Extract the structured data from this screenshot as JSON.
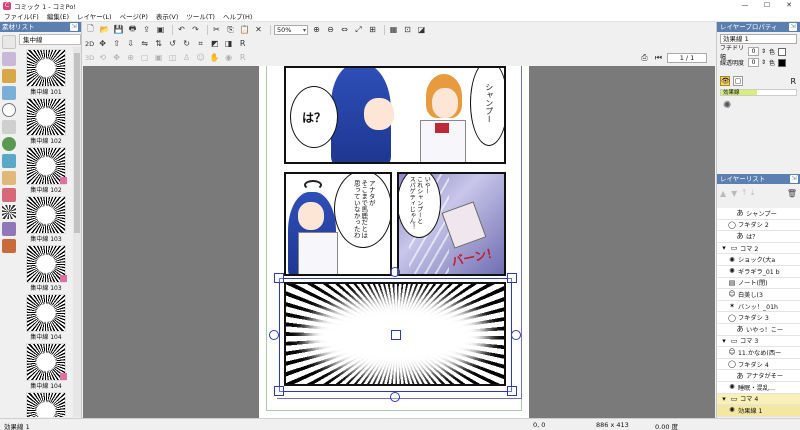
{
  "window": {
    "title": "コミック 1 - コミPo!",
    "app_icon": "comipo-app-icon",
    "controls": [
      "—",
      "☐",
      "✕"
    ]
  },
  "menu": [
    "ファイル(F)",
    "編集(E)",
    "レイヤー(L)",
    "ページ(P)",
    "表示(V)",
    "ツール(T)",
    "ヘルプ(H)"
  ],
  "left_panel": {
    "title": "素材リスト",
    "folder": "集中線",
    "materials": [
      {
        "label": "集中線 101",
        "marked": false
      },
      {
        "label": "集中線 102",
        "marked": false
      },
      {
        "label": "集中線 102",
        "marked": true
      },
      {
        "label": "集中線 103",
        "marked": false
      },
      {
        "label": "集中線 103",
        "marked": true
      },
      {
        "label": "集中線 104",
        "marked": false
      },
      {
        "label": "集中線 104",
        "marked": true
      },
      {
        "label": "",
        "marked": false
      }
    ]
  },
  "toolbar": {
    "zoom": "50%",
    "mode": "2D",
    "page_indicator": "1 / 1"
  },
  "canvas": {
    "bubbles": {
      "top_left": "は？",
      "top_right": "シャンプー",
      "mid_left": "アナタが\nそこまで馬鹿だとは\n思っていなかったわ",
      "mid_right": "いやー\nこれシャンプーと\nスパゲティじゃん！",
      "sfx": "バーン！"
    }
  },
  "right_panel": {
    "properties_title": "レイヤープロパティ",
    "layer_name": "効果線 1",
    "border_width_label": "フチドリ幅",
    "border_width_value": "0",
    "border_color_label": "色",
    "line_opacity_label": "線透明度",
    "line_opacity_value": "0",
    "line_color_label": "色",
    "effect_label": "効果線",
    "layers_title": "レイヤーリスト",
    "layers": [
      {
        "label": "シャンプー",
        "indent": 2,
        "icon": "text-a-icon",
        "sel": false
      },
      {
        "label": "フキダシ 2",
        "indent": 1,
        "icon": "bubble-icon",
        "sel": false
      },
      {
        "label": "は？",
        "indent": 2,
        "icon": "text-a-icon",
        "sel": false
      },
      {
        "label": "コマ 2",
        "indent": 0,
        "icon": "frame-icon",
        "sel": false
      },
      {
        "label": "ショック(大a",
        "indent": 1,
        "icon": "effect-icon",
        "sel": false
      },
      {
        "label": "ギラギラ_01 b",
        "indent": 1,
        "icon": "effect-icon",
        "sel": false
      },
      {
        "label": "ノート(閉)",
        "indent": 1,
        "icon": "item-icon",
        "sel": false
      },
      {
        "label": "白美し(3",
        "indent": 1,
        "icon": "character-icon",
        "sel": false
      },
      {
        "label": "バンッ！_01h",
        "indent": 1,
        "icon": "sfx-icon",
        "sel": false
      },
      {
        "label": "フキダシ 3",
        "indent": 1,
        "icon": "bubble-icon",
        "sel": false
      },
      {
        "label": "いやっ！こー",
        "indent": 2,
        "icon": "text-a-icon",
        "sel": false
      },
      {
        "label": "コマ 3",
        "indent": 0,
        "icon": "frame-icon",
        "sel": false
      },
      {
        "label": "11.かなめ(西ー",
        "indent": 1,
        "icon": "character-icon",
        "sel": false
      },
      {
        "label": "フキダシ 4",
        "indent": 1,
        "icon": "bubble-icon",
        "sel": false
      },
      {
        "label": "アナタがそー",
        "indent": 2,
        "icon": "text-a-icon",
        "sel": false
      },
      {
        "label": "睡眠・混乱…",
        "indent": 1,
        "icon": "effect-icon",
        "sel": false
      },
      {
        "label": "コマ 4",
        "indent": 0,
        "icon": "frame-icon",
        "sel": "head"
      },
      {
        "label": "効果線 1",
        "indent": 1,
        "icon": "effect-icon",
        "sel": true
      }
    ]
  },
  "status": {
    "layer": "効果線 1",
    "position": "0, 0",
    "size": "886 x 413",
    "angle": "0.00 度"
  }
}
